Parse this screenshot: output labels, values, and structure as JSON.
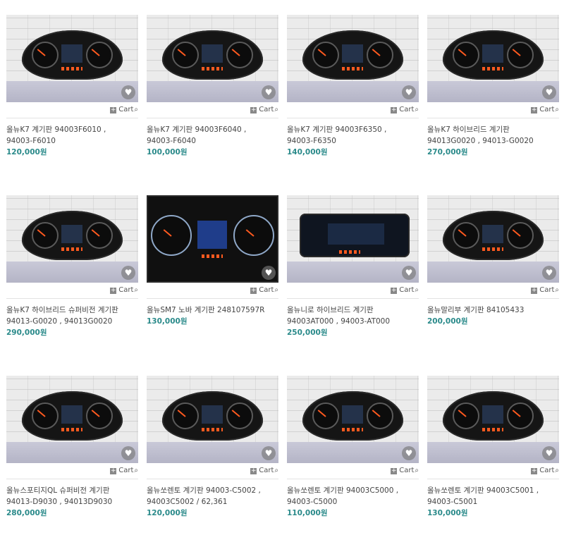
{
  "cart_label": "Cart",
  "heart_icon": "heart-icon",
  "products": [
    {
      "name": "올뉴K7 계기판 94003F6010 ,\n94003-F6010",
      "price": "120,000원",
      "style": "light"
    },
    {
      "name": "올뉴K7 계기판 94003F6040 ,\n94003-F6040",
      "price": "100,000원",
      "style": "light"
    },
    {
      "name": "올뉴K7 계기판 94003F6350 ,\n94003-F6350",
      "price": "140,000원",
      "style": "light"
    },
    {
      "name": "올뉴K7 하이브리드 계기판\n94013G0020 , 94013-G0020",
      "price": "270,000원",
      "style": "light"
    },
    {
      "name": "올뉴K7 하이브리드 슈퍼비전 계기판\n94013-G0020 , 94013G0020",
      "price": "290,000원",
      "style": "light"
    },
    {
      "name": "올뉴SM7 노바 계기판 248107597R",
      "price": "130,000원",
      "style": "dark"
    },
    {
      "name": "올뉴니로 하이브리드 계기판\n94003AT000 , 94003-AT000",
      "price": "250,000원",
      "style": "wide"
    },
    {
      "name": "올뉴말리부 계기판 84105433",
      "price": "200,000원",
      "style": "light"
    },
    {
      "name": "올뉴스포티지QL 슈퍼비전 계기판\n94013-D9030 , 94013D9030",
      "price": "280,000원",
      "style": "light"
    },
    {
      "name": "올뉴쏘렌토 계기판 94003-C5002 ,\n94003C5002 / 62,361",
      "price": "120,000원",
      "style": "light"
    },
    {
      "name": "올뉴쏘렌토 계기판 94003C5000 ,\n94003-C5000",
      "price": "110,000원",
      "style": "light"
    },
    {
      "name": "올뉴쏘렌토 계기판 94003C5001 ,\n94003-C5001",
      "price": "130,000원",
      "style": "light"
    }
  ]
}
